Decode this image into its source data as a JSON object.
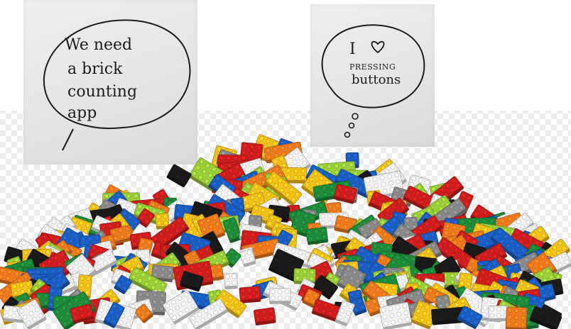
{
  "note_left": {
    "lines": [
      "We need",
      "a brick",
      "counting",
      "app"
    ]
  },
  "note_right": {
    "line1": "I",
    "line2": "PRESSING",
    "line3": "buttons"
  },
  "colors": {
    "red": "#d01e1e",
    "blue": "#1c5fc4",
    "yellow": "#f5c21b",
    "green": "#1e8c3a",
    "white": "#f2f2f2",
    "black": "#1a1a1a",
    "orange": "#f07b1e",
    "lime": "#9ccf3a",
    "gray": "#8a8a8a"
  }
}
